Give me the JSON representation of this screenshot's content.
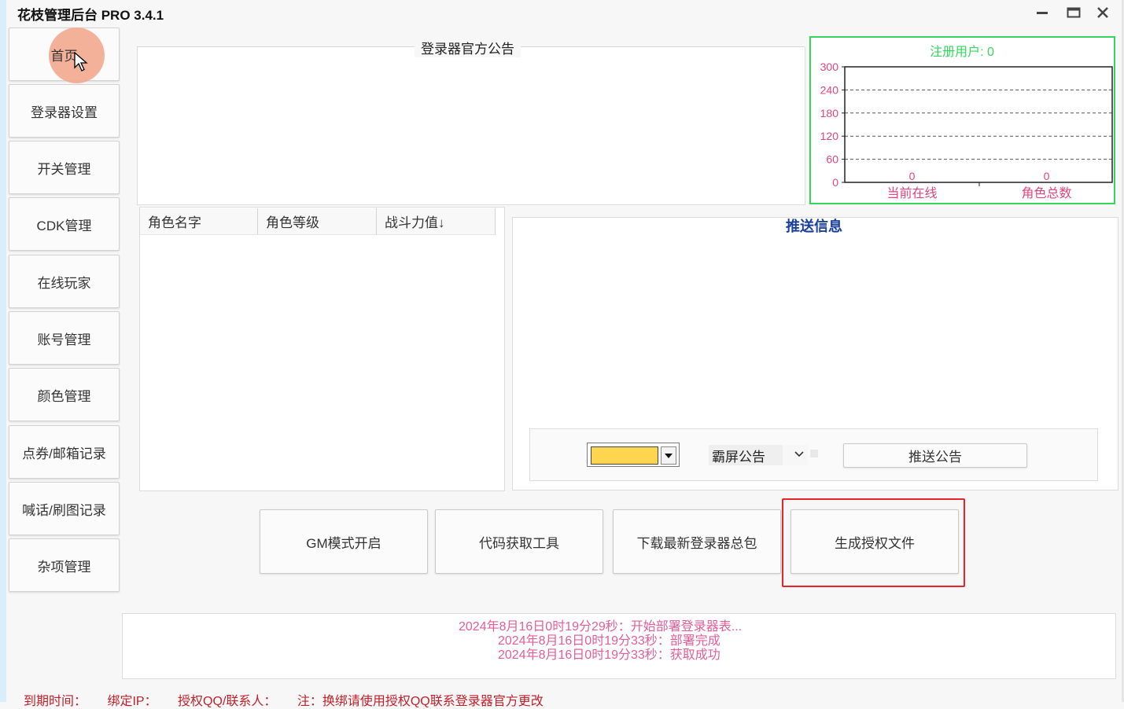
{
  "window": {
    "title": "花枝管理后台 PRO 3.4.1",
    "minimize_icon": "minimize-icon",
    "maximize_icon": "maximize-icon",
    "close_icon": "close-icon"
  },
  "sidebar": {
    "items": [
      {
        "label": "首页",
        "active": true
      },
      {
        "label": "登录器设置"
      },
      {
        "label": "开关管理"
      },
      {
        "label": "CDK管理"
      },
      {
        "label": "在线玩家"
      },
      {
        "label": "账号管理"
      },
      {
        "label": "颜色管理"
      },
      {
        "label": "点券/邮箱记录"
      },
      {
        "label": "喊话/刷图记录"
      },
      {
        "label": "杂项管理"
      }
    ]
  },
  "notice": {
    "title": "登录器官方公告"
  },
  "stats_chart": {
    "title": "注册用户: 0",
    "frame_color": "#34d65c",
    "label_color": "#e0457b"
  },
  "chart_data": {
    "type": "bar",
    "title": "注册用户: 0",
    "categories": [
      "当前在线",
      "角色总数"
    ],
    "values": [
      0,
      0
    ],
    "yticks": [
      0,
      60,
      120,
      180,
      240,
      300
    ],
    "ylim": [
      0,
      300
    ],
    "grid": true,
    "data_labels": true
  },
  "role_table": {
    "columns": [
      "角色名字",
      "角色等级",
      "战斗力值↓"
    ],
    "rows": []
  },
  "push": {
    "title": "推送信息",
    "color_value": "#ffd54f",
    "type_selected": "霸屏公告",
    "send_label": "推送公告"
  },
  "actions": {
    "gm_mode": "GM模式开启",
    "code_tool": "代码获取工具",
    "download_pack": "下载最新登录器总包",
    "gen_license": "生成授权文件"
  },
  "log": {
    "lines": [
      "2024年8月16日0时19分29秒：开始部署登录器表...",
      "2024年8月16日0时19分33秒：部署完成",
      "2024年8月16日0时19分33秒：获取成功"
    ]
  },
  "footer": {
    "expire": "到期时间：",
    "bind_ip": "绑定IP：",
    "auth_qq": "授权QQ/联系人：",
    "note": "注：换绑请使用授权QQ联系登录器官方更改"
  }
}
